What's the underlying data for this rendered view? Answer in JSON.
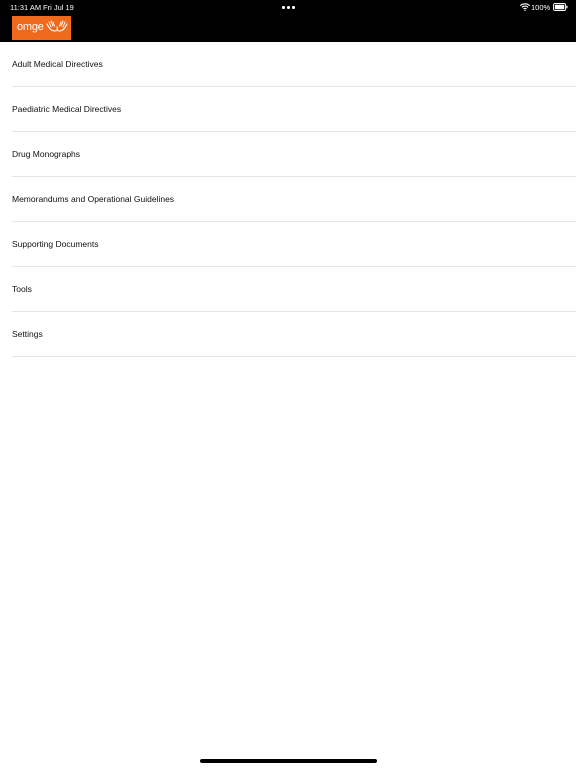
{
  "status_bar": {
    "time": "11:31 AM",
    "date": "Fri Jul 19",
    "battery_percent": "100%",
    "wifi_icon": "wifi-icon",
    "battery_icon": "battery-icon",
    "multitask_icon": "multitask-dots-icon"
  },
  "header": {
    "logo_text": "omge",
    "logo_icon": "hands-logo-icon",
    "logo_color": "#f06a1e",
    "bar_color": "#000000"
  },
  "menu": {
    "items": [
      {
        "label": "Adult Medical Directives"
      },
      {
        "label": "Paediatric Medical Directives"
      },
      {
        "label": "Drug Monographs"
      },
      {
        "label": "Memorandums and Operational Guidelines"
      },
      {
        "label": "Supporting Documents"
      },
      {
        "label": "Tools"
      },
      {
        "label": "Settings"
      }
    ]
  }
}
